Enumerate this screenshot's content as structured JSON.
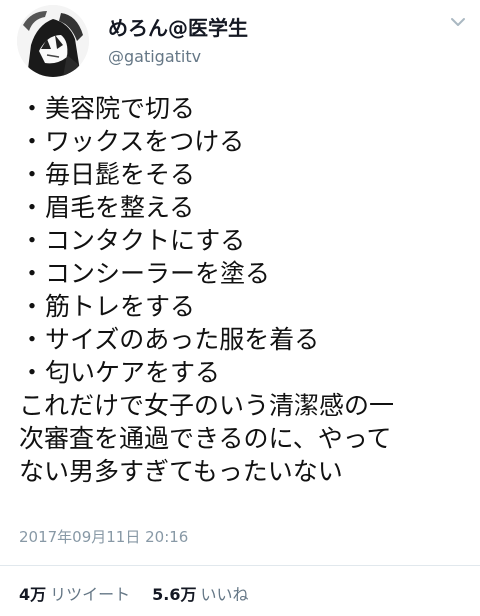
{
  "tweet": {
    "display_name": "めろん@医学生",
    "handle": "@gatigatitv",
    "list_items": [
      "美容院で切る",
      "ワックスをつける",
      "毎日髭をそる",
      "眉毛を整える",
      "コンタクトにする",
      "コンシーラーを塗る",
      "筋トレをする",
      "サイズのあった服を着る",
      "匂いケアをする"
    ],
    "bullet": "・",
    "closing_lines": [
      "これだけで女子のいう清潔感の一",
      "次審査を通過できるのに、やって",
      "ない男多すぎてもったいない"
    ],
    "timestamp": "2017年09月11日 20:16",
    "retweets_count": "4万",
    "retweets_label": "リツイート",
    "likes_count": "5.6万",
    "likes_label": "いいね"
  },
  "icons": {
    "menu_caret": "chevron-down-icon",
    "avatar": "anime-avatar"
  }
}
